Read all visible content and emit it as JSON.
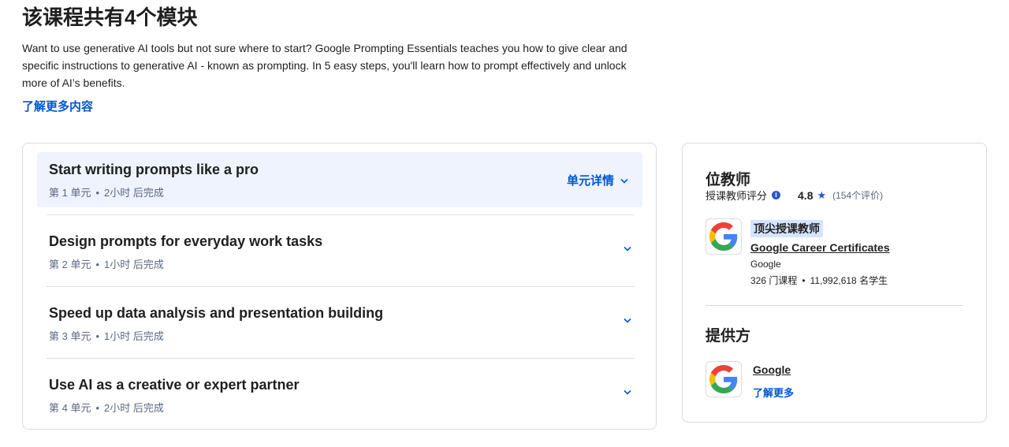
{
  "header": {
    "title": "该课程共有4个模块",
    "description": "Want to use generative AI tools but not sure where to start? Google Prompting Essentials teaches you how to give clear and specific instructions to generative AI - known as prompting. In 5 easy steps, you'll learn how to prompt effectively and unlock more of AI’s benefits.",
    "learn_more": "了解更多内容"
  },
  "modules": [
    {
      "title": "Start writing prompts like a pro",
      "unit": "第 1 单元",
      "duration": "2小时 后完成",
      "details_label": "单元详情",
      "expanded": true
    },
    {
      "title": "Design prompts for everyday work tasks",
      "unit": "第 2 单元",
      "duration": "1小时 后完成"
    },
    {
      "title": "Speed up data analysis and presentation building",
      "unit": "第 3 单元",
      "duration": "1小时 后完成"
    },
    {
      "title": "Use AI as a creative or expert partner",
      "unit": "第 4 单元",
      "duration": "2小时 后完成"
    }
  ],
  "meta_separator": "•",
  "instructors": {
    "heading": "位教师",
    "rating_label": "授课教师评分",
    "rating": "4.8",
    "rating_count": "(154个评价)",
    "badge": "顶尖授课教师",
    "name": "Google Career Certificates",
    "org": "Google",
    "courses": "326 门课程",
    "students": "11,992,618 名学生",
    "logo_icon": "google-logo-icon"
  },
  "provider": {
    "heading": "提供方",
    "name": "Google",
    "learn_more": "了解更多",
    "logo_icon": "google-logo-icon"
  },
  "colors": {
    "accent": "#0056d2",
    "active_bg": "#eef3fd",
    "badge_bg": "#d5e4ff",
    "star": "#2a56c6"
  }
}
